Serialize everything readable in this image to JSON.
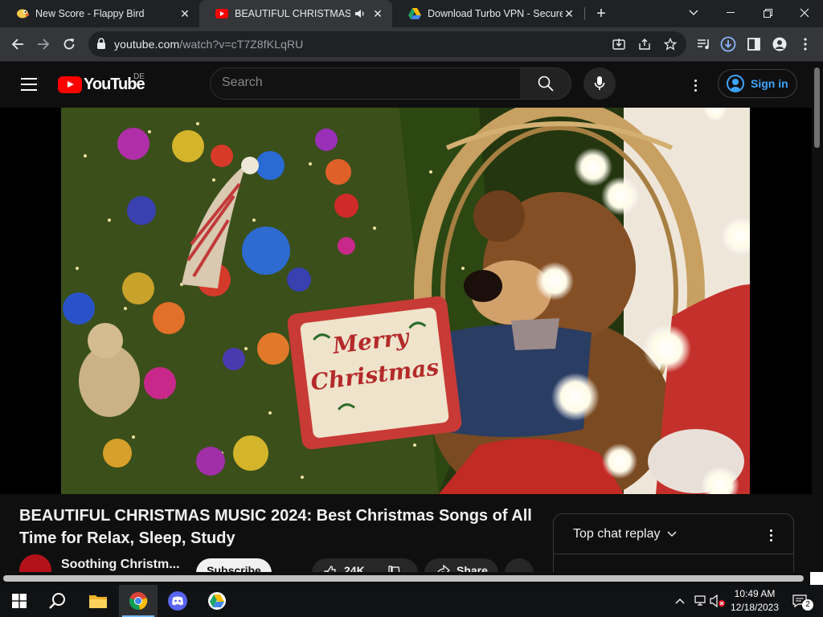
{
  "browser": {
    "tabs": [
      {
        "title": "New Score - Flappy Bird",
        "active": false
      },
      {
        "title": "BEAUTIFUL CHRISTMAS MU",
        "active": true,
        "audio": true
      },
      {
        "title": "Download Turbo VPN - Secure V",
        "active": false
      }
    ],
    "url_host": "youtube.com",
    "url_path": "/watch?v=cT7Z8fKLqRU"
  },
  "youtube": {
    "logo_text": "YouTube",
    "country_code": "DE",
    "search_placeholder": "Search",
    "signin_label": "Sign in",
    "video_title": "BEAUTIFUL CHRISTMAS MUSIC 2024: Best Christmas Songs of All Time for Relax, Sleep, Study",
    "channel_name": "Soothing Christm...",
    "subscribe_label": "Subscribe",
    "like_count": "24K",
    "share_label": "Share",
    "chat_header": "Top chat replay",
    "pillow_text_1": "Merry",
    "pillow_text_2": "Christmas"
  },
  "taskbar": {
    "time": "10:49 AM",
    "date": "12/18/2023",
    "notification_count": "2",
    "apps": [
      "start",
      "search",
      "file-explorer",
      "chrome",
      "discord",
      "google-drive"
    ]
  },
  "colors": {
    "yt_red": "#ff0000",
    "link_blue": "#3ea6ff",
    "chrome_dark": "#202124",
    "chrome_toolbar": "#35363a"
  }
}
